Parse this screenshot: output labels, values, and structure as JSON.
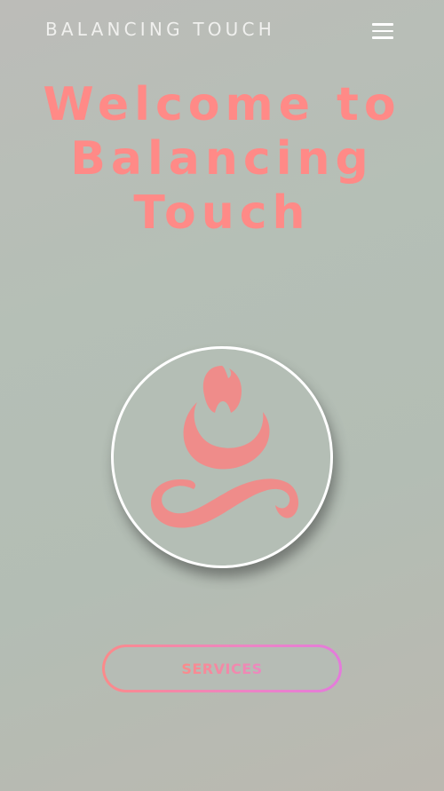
{
  "header": {
    "brand": "BALANCING TOUCH",
    "menu_icon": "hamburger-menu-icon"
  },
  "hero": {
    "title_lines": [
      "Welcome to",
      "Balancing",
      "Touch"
    ]
  },
  "logo": {
    "icon": "meditation-figure-icon"
  },
  "cta": {
    "services_label": "SERVICES"
  },
  "colors": {
    "accent": "#ff8a87",
    "gradient_end": "#e47bdb",
    "header_text": "#f0f0ee"
  }
}
